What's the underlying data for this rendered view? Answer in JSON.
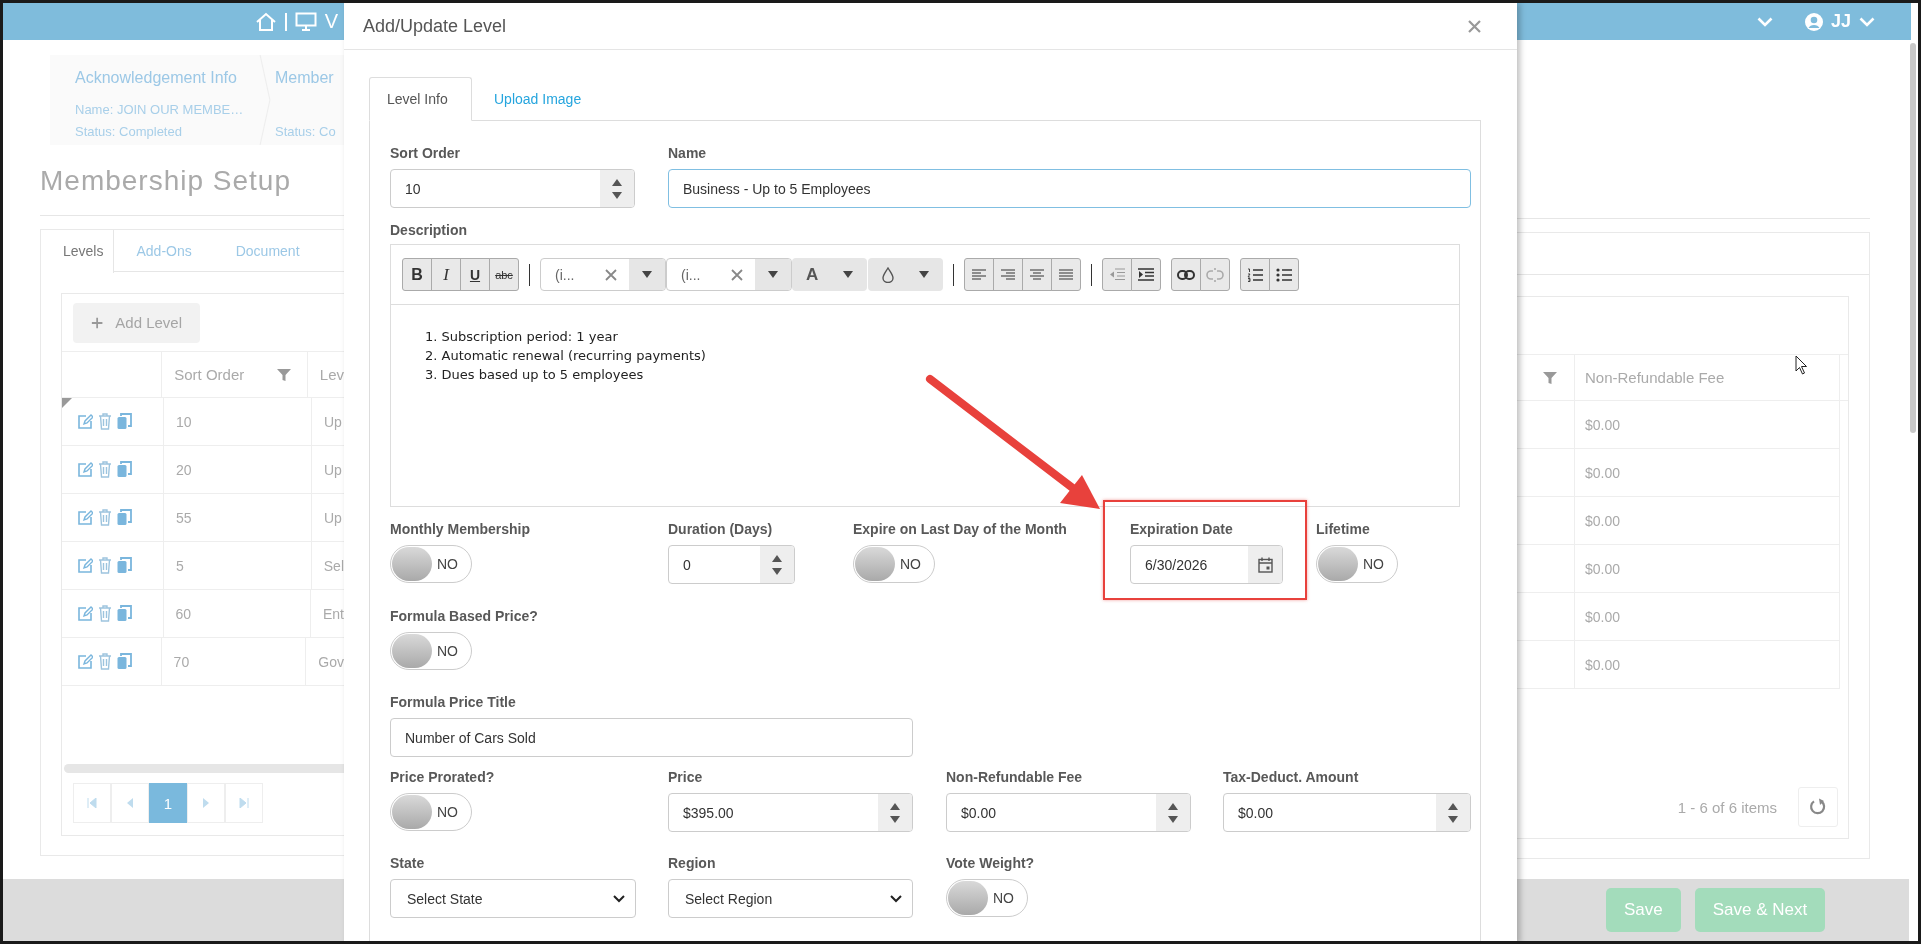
{
  "top_bar": {
    "app_initial": "V",
    "user_initials": "JJ"
  },
  "breadcrumbs": [
    {
      "title": "Acknowledgement Info",
      "name": "Name: JOIN OUR MEMBE…",
      "status": "Status: Completed"
    },
    {
      "title": "Member",
      "status": "Status: Co"
    }
  ],
  "page_title": "Membership Setup",
  "page_tabs": [
    {
      "label": "Levels",
      "selected": true
    },
    {
      "label": "Add-Ons",
      "selected": false
    },
    {
      "label": "Document",
      "selected": false
    }
  ],
  "levels_grid": {
    "add_button": "Add Level",
    "columns": [
      "Sort Order",
      "Lev",
      "Non-Refundable Fee"
    ],
    "rows": [
      {
        "sort_order": "10",
        "level": "Up",
        "fee": "$0.00"
      },
      {
        "sort_order": "20",
        "level": "Up",
        "fee": "$0.00"
      },
      {
        "sort_order": "55",
        "level": "Up",
        "fee": "$0.00"
      },
      {
        "sort_order": "5",
        "level": "Sel",
        "fee": "$0.00"
      },
      {
        "sort_order": "60",
        "level": "Ent",
        "fee": "$0.00"
      },
      {
        "sort_order": "70",
        "level": "Gov",
        "fee": "$0.00"
      }
    ],
    "pages": [
      {
        "label": "1",
        "selected": true
      }
    ],
    "summary": "1 - 6 of 6 items"
  },
  "footer_buttons": [
    "Save",
    "Save & Next"
  ],
  "modal": {
    "title": "Add/Update Level",
    "tabs": [
      {
        "label": "Level Info",
        "selected": true
      },
      {
        "label": "Upload Image",
        "selected": false
      }
    ],
    "fields_top": [
      {
        "kind": "number",
        "label": "Sort Order",
        "value": "10"
      },
      {
        "kind": "text",
        "label": "Name",
        "value": "Business - Up to 5 Employees",
        "focused": true
      }
    ],
    "description": {
      "label": "Description",
      "toolbar": {
        "format_buttons": [
          "B",
          "I",
          "U",
          "abc"
        ],
        "font_name": "(i...",
        "font_size": "(i...",
        "text_color": "A"
      },
      "lines": [
        "1. Subscription period: 1 year",
        "2. Automatic renewal (recurring payments)",
        "3. Dues based up to 5 employees"
      ]
    },
    "form_rows": [
      [
        {
          "kind": "toggle",
          "label": "Monthly Membership",
          "on": false,
          "text": "NO"
        },
        {
          "kind": "number",
          "label": "Duration (Days)",
          "value": "0"
        },
        {
          "kind": "toggle",
          "label": "Expire on Last Day of the Month",
          "on": false,
          "text": "NO"
        },
        {
          "kind": "date",
          "label": "Expiration Date",
          "value": "6/30/2026",
          "highlighted": true
        },
        {
          "kind": "toggle",
          "label": "Lifetime",
          "on": false,
          "text": "NO"
        }
      ],
      [
        {
          "kind": "toggle",
          "label": "Formula Based Price?",
          "on": false,
          "text": "NO"
        }
      ],
      [
        {
          "kind": "text",
          "label": "Formula Price Title",
          "value": "Number of Cars Sold",
          "focused": false
        }
      ],
      [
        {
          "kind": "toggle",
          "label": "Price Prorated?",
          "on": false,
          "text": "NO"
        },
        {
          "kind": "number",
          "label": "Price",
          "value": "$395.00"
        },
        {
          "kind": "number",
          "label": "Non-Refundable Fee",
          "value": "$0.00"
        },
        {
          "kind": "number",
          "label": "Tax-Deduct. Amount",
          "value": "$0.00"
        }
      ],
      [
        {
          "kind": "select",
          "label": "State",
          "value": "Select State"
        },
        {
          "kind": "select",
          "label": "Region",
          "value": "Select Region"
        },
        {
          "kind": "toggle",
          "label": "Vote Weight?",
          "on": false,
          "text": "NO"
        }
      ]
    ]
  }
}
